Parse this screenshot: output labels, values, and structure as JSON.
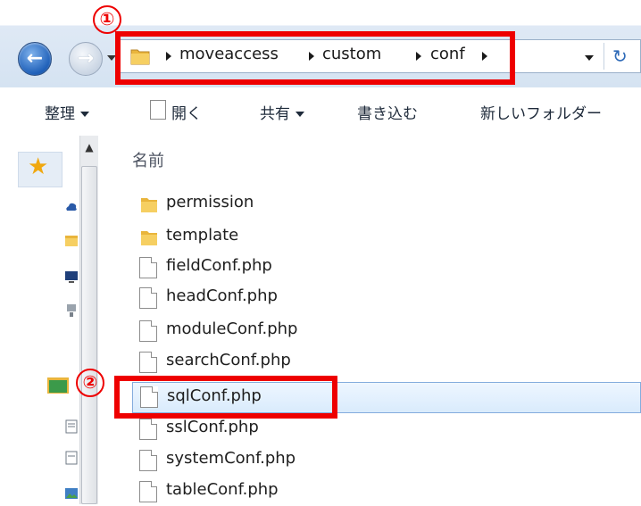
{
  "annotations": {
    "callout_1": "①",
    "callout_2": "②"
  },
  "address_bar": {
    "crumbs": [
      "moveaccess",
      "custom",
      "conf"
    ]
  },
  "toolbar": {
    "organize": "整理",
    "open": "開く",
    "share": "共有",
    "burn": "書き込む",
    "new_folder": "新しいフォルダー"
  },
  "file_list": {
    "column_name": "名前",
    "items": [
      {
        "name": "permission",
        "type": "folder"
      },
      {
        "name": "template",
        "type": "folder"
      },
      {
        "name": "fieldConf.php",
        "type": "file"
      },
      {
        "name": "headConf.php",
        "type": "file"
      },
      {
        "name": "moduleConf.php",
        "type": "file"
      },
      {
        "name": "searchConf.php",
        "type": "file"
      },
      {
        "name": "sqlConf.php",
        "type": "file",
        "selected": true
      },
      {
        "name": "sslConf.php",
        "type": "file"
      },
      {
        "name": "systemConf.php",
        "type": "file"
      },
      {
        "name": "tableConf.php",
        "type": "file"
      }
    ]
  },
  "colors": {
    "highlight_red": "#ee0000",
    "selection": "#d9ebfc",
    "folder": "#f2c14e"
  }
}
